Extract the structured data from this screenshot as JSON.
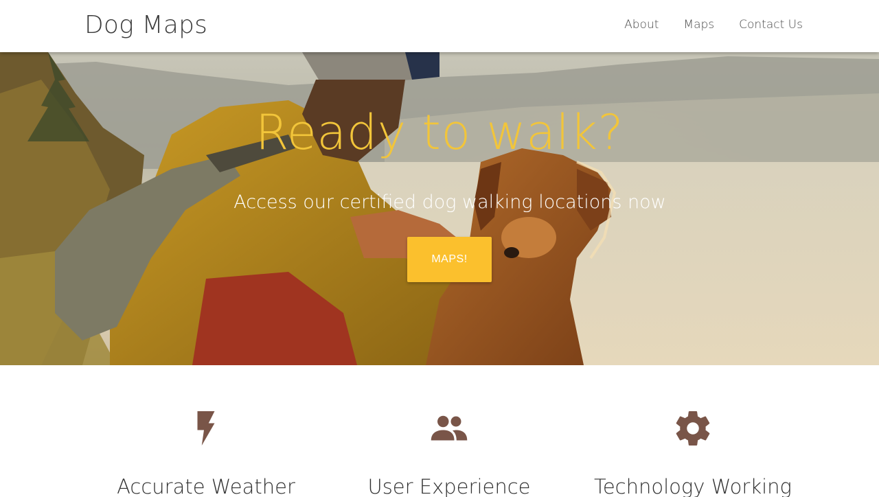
{
  "navbar": {
    "brand": "Dog Maps",
    "links": [
      "About",
      "Maps",
      "Contact Us"
    ]
  },
  "hero": {
    "title": "Ready to walk?",
    "subtitle": "Access our certified dog walking locations now",
    "button_label": "MAPS!"
  },
  "features": [
    {
      "icon": "bolt-icon",
      "heading": "Accurate Weather"
    },
    {
      "icon": "group-icon",
      "heading": "User Experience"
    },
    {
      "icon": "gear-icon",
      "heading": "Technology Working"
    }
  ],
  "colors": {
    "accent": "#fbc02d",
    "title": "#f2c53a",
    "icon": "#795548"
  }
}
